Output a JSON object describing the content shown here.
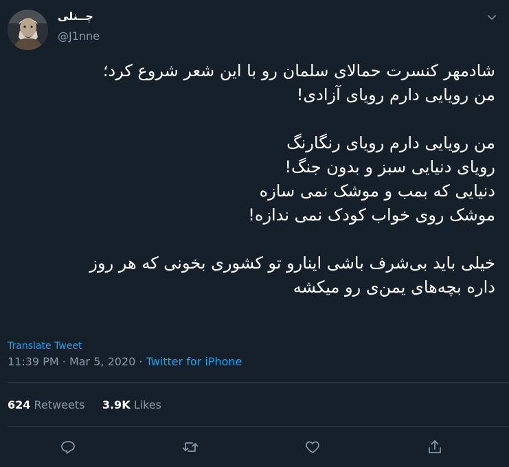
{
  "author": {
    "display_name": "چــنلی",
    "handle": "@J1nne"
  },
  "tweet": {
    "lines": [
      "شادمهر کنسرت حمالای سلمان رو با این شعر شروع کرد؛",
      "من رویایی دارم رویای آزادی!",
      "",
      "من رویایی دارم رویای رنگارنگ",
      "رویای دنیایی سبز و بدون جنگ!",
      "دنیایی که بمب و موشک نمی سازه",
      "موشک روی خواب کودک نمی ندازه!",
      "",
      "خیلی باید بی‌شرف باشی اینارو تو کشوری بخونی که هر روز",
      "داره بچه‌های یمن‌ی رو میکشه"
    ]
  },
  "translate_label": "Translate Tweet",
  "meta": {
    "time": "11:39 PM",
    "separator": "·",
    "date": "Mar 5, 2020",
    "source": "Twitter for iPhone"
  },
  "stats": {
    "retweets_count": "624",
    "retweets_label": "Retweets",
    "likes_count": "3.9K",
    "likes_label": "Likes"
  },
  "icons": {
    "reply": "reply-icon",
    "retweet": "retweet-icon",
    "like": "like-icon",
    "share": "share-icon",
    "caret": "chevron-down-icon"
  },
  "colors": {
    "background": "#15202b",
    "accent": "#1da1f2",
    "secondary_text": "#8899a6",
    "divider": "#38444d"
  }
}
